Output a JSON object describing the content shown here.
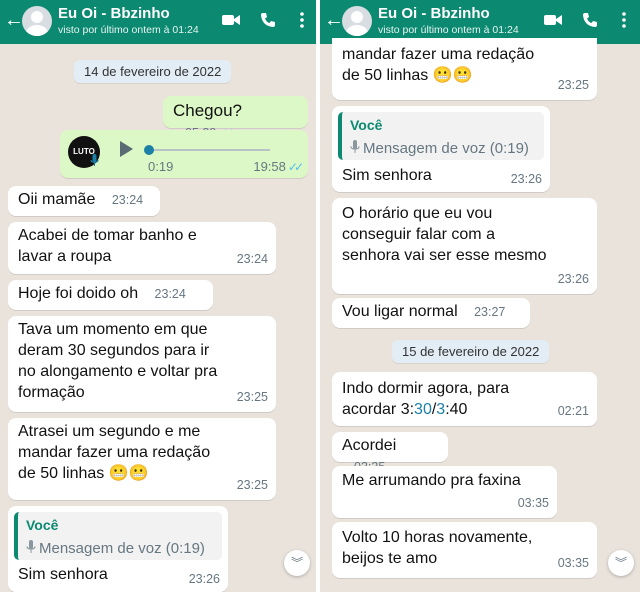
{
  "left": {
    "header": {
      "back_icon": "arrow-left-icon",
      "contact_name": "Eu Oi - Bbzinho",
      "status": "visto por último ontem à 01:24"
    },
    "date_chip": "14 de fevereiro de 2022",
    "messages": [
      {
        "text": "Chegou?",
        "time": "05:29"
      },
      {
        "voice_avatar": "LUTO",
        "elapsed": "0:19",
        "time": "19:58"
      },
      {
        "text": "Oii mamãe",
        "time": "23:24"
      },
      {
        "line1": "Acabei de tomar banho e",
        "line2": "lavar a roupa",
        "time": "23:24"
      },
      {
        "text": "Hoje foi doido oh",
        "time": "23:24"
      },
      {
        "line1": "Tava um momento em que",
        "line2": "deram 30 segundos para ir",
        "line3": "no alongamento e voltar pra",
        "line4": "formação",
        "time": "23:25"
      },
      {
        "line1": "Atrasei um segundo e me",
        "line2": "mandar fazer uma redação",
        "line3": "de 50 linhas 😬😬",
        "time": "23:25"
      },
      {
        "quote_name": "Você",
        "quote_text": "Mensagem de voz (0:19)",
        "text": "Sim senhora",
        "time": "23:26"
      }
    ]
  },
  "right": {
    "header": {
      "back_icon": "arrow-left-icon",
      "contact_name": "Eu Oi - Bbzinho",
      "status": "visto por último ontem à 01:24"
    },
    "messages": [
      {
        "line1": "mandar fazer uma redação",
        "line2": "de 50 linhas 😬😬",
        "time": "23:25"
      },
      {
        "quote_name": "Você",
        "quote_text": "Mensagem de voz (0:19)",
        "text": "Sim senhora",
        "time": "23:26"
      },
      {
        "line1": "O horário que eu vou",
        "line2": "conseguir falar com a",
        "line3": "senhora vai ser esse mesmo",
        "time": "23:26"
      },
      {
        "text": "Vou ligar normal",
        "time": "23:27"
      },
      {
        "line1": "Indo dormir agora, para",
        "line2_a": "acordar 3:",
        "line2_b": "30",
        "line2_c": "/",
        "line2_d": "3",
        "line2_e": ":40",
        "time": "02:21"
      },
      {
        "text": "Acordei",
        "time": "03:35"
      },
      {
        "text": "Me arrumando pra faxina",
        "time": "03:35"
      },
      {
        "line1": "Volto 10 horas novamente,",
        "line2": "beijos te amo",
        "time": "03:35"
      }
    ],
    "date_chip": "15 de fevereiro de 2022"
  },
  "colors": {
    "header": "#0b8a71",
    "outgoing": "#dcf8c6",
    "incoming": "#ffffff",
    "wallpaper": "#e9e3dc",
    "read_ticks": "#53bdeb"
  },
  "icons": [
    "arrow-left-icon",
    "video-call-icon",
    "phone-icon",
    "more-vert-icon",
    "play-icon",
    "mic-icon",
    "double-check-icon",
    "chevron-double-down-icon"
  ]
}
